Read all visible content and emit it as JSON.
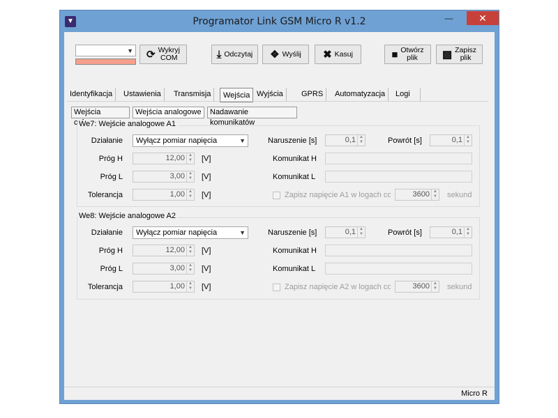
{
  "window": {
    "title": "Programator Link GSM Micro R v1.2"
  },
  "toolbar": {
    "com_label_1": "Wykryj",
    "com_label_2": "COM",
    "read_label": "Odczytaj",
    "send_label": "Wyślij",
    "delete_label": "Kasuj",
    "open_label_1": "Otwórz",
    "open_label_2": "plik",
    "save_label_1": "Zapisz",
    "save_label_2": "plik"
  },
  "tabs": [
    "Identyfikacja",
    "Ustawienia",
    "Transmisja",
    "Wejścia",
    "Wyjścia",
    "GPRS",
    "Automatyzacja",
    "Logi"
  ],
  "active_tab": "Wejścia",
  "subtabs": [
    "Wejścia cyfrowe",
    "Wejścia analogowe",
    "Nadawanie komunikatów"
  ],
  "active_subtab": "Wejścia analogowe",
  "labels": {
    "action": "Działanie",
    "thr_h": "Próg H",
    "thr_l": "Próg L",
    "tolerance": "Tolerancja",
    "violation": "Naruszenie [s]",
    "return": "Powrót [s]",
    "msg_h": "Komunikat H",
    "msg_l": "Komunikat L",
    "unit_v": "[V]",
    "seconds": "sekund"
  },
  "inputs": [
    {
      "title": "We7: Wejście analogowe A1",
      "action": "Wyłącz pomiar napięcia",
      "thr_h": "12,00",
      "thr_l": "3,00",
      "tolerance": "1,00",
      "violation": "0,1",
      "return": "0,1",
      "log_label": "Zapisz napięcie A1 w logach co",
      "log_interval": "3600"
    },
    {
      "title": "We8: Wejście analogowe A2",
      "action": "Wyłącz pomiar napięcia",
      "thr_h": "12,00",
      "thr_l": "3,00",
      "tolerance": "1,00",
      "violation": "0,1",
      "return": "0,1",
      "log_label": "Zapisz napięcie A2 w logach co",
      "log_interval": "3600"
    }
  ],
  "status": {
    "device": "Micro R"
  },
  "colors": {
    "window_frame": "#6fa1d4",
    "close_button": "#c7413a",
    "com_status": "#f4a08c"
  }
}
